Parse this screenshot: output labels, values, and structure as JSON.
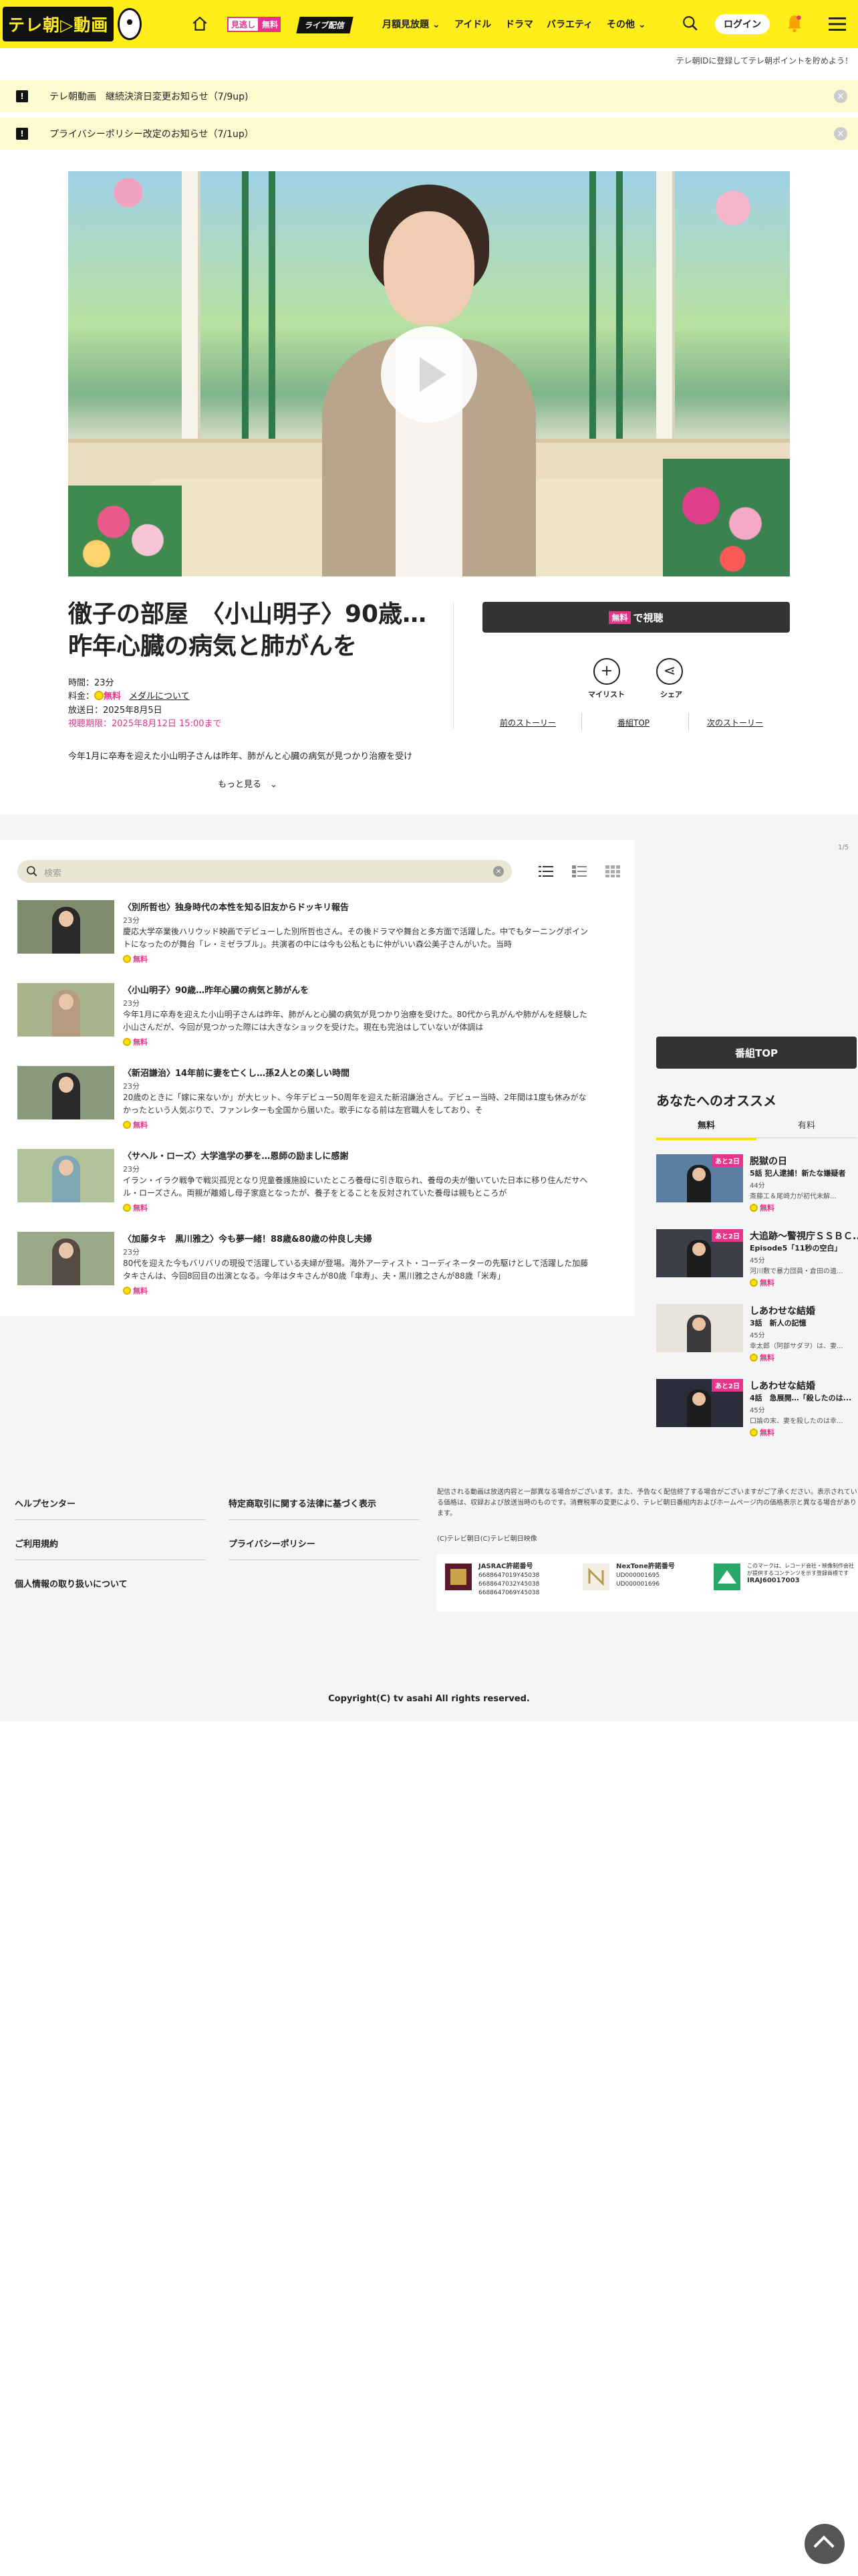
{
  "header": {
    "logo_text": "テレ朝▷動画",
    "free_badge_a": "見逃し",
    "free_badge_b": "無料",
    "live_badge": "ライブ配信",
    "nav": [
      "月額見放題",
      "アイドル",
      "ドラマ",
      "バラエティ",
      "その他"
    ],
    "login": "ログイン"
  },
  "promo": "テレ朝IDに登録してテレ朝ポイントを貯めよう！",
  "notices": [
    {
      "text": "テレ朝動画　継続決済日変更お知らせ（7/9up)"
    },
    {
      "text": "プライバシーポリシー改定のお知らせ（7/1up）"
    }
  ],
  "program": {
    "title": "徹子の部屋　〈小山明子〉90歳…昨年心臓の病気と肺がんを",
    "time": "時間：23分",
    "fee_label": "料金：",
    "fee_value": "無料",
    "medal_link": "メダルについて",
    "aired": "放送日：2025年8月5日",
    "deadline": "視聴期限：2025年8月12日 15:00まで",
    "desc": "今年1月に卒寿を迎えた小山明子さんは昨年、肺がんと心臓の病気が見つかり治療を受け",
    "more": "もっと見る",
    "watch_tag": "無料",
    "watch_label": "で視聴",
    "mylist": "マイリスト",
    "share": "シェア",
    "prev": "前のストーリー",
    "top": "番組TOP",
    "next": "次のストーリー"
  },
  "search": {
    "placeholder": "検索"
  },
  "page_num": "1/5",
  "episodes": [
    {
      "title": "〈別所哲也〉独身時代の本性を知る旧友からドッキリ報告",
      "duration": "23分",
      "desc": "慶応大学卒業後ハリウッド映画でデビューした別所哲也さん。その後ドラマや舞台と多方面で活躍した。中でもターニングポイントになったのが舞台「レ・ミゼラブル」。共演者の中には今も公私ともに仲がいい森公美子さんがいた。当時",
      "free": "無料"
    },
    {
      "title": "〈小山明子〉90歳…昨年心臓の病気と肺がんを",
      "duration": "23分",
      "desc": "今年1月に卒寿を迎えた小山明子さんは昨年、肺がんと心臓の病気が見つかり治療を受けた。80代から乳がんや肺がんを経験した小山さんだが、今回が見つかった際には大きなショックを受けた。現在も完治はしていないが体調は",
      "free": "無料"
    },
    {
      "title": "〈新沼謙治〉14年前に妻を亡くし…孫2人との楽しい時間",
      "duration": "23分",
      "desc": "20歳のときに「嫁に来ないか」が大ヒット、今年デビュー50周年を迎えた新沼謙治さん。デビュー当時、2年間は1度も休みがなかったという人気ぶりで、ファンレターも全国から届いた。歌手になる前は左官職人をしており、そ",
      "free": "無料"
    },
    {
      "title": "〈サヘル・ローズ〉大学進学の夢を…恩師の励ましに感謝",
      "duration": "23分",
      "desc": "イラン・イラク戦争で戦災孤児となり児童養護施設にいたところ養母に引き取られ、養母の夫が働いていた日本に移り住んだサヘル・ローズさん。両親が離婚し母子家庭となったが、養子をとることを反対されていた養母は親もところが",
      "free": "無料"
    },
    {
      "title": "〈加藤タキ　黒川雅之〉今も夢一緒！88歳&80歳の仲良し夫婦",
      "duration": "23分",
      "desc": "80代を迎えた今もバリバリの現役で活躍している夫婦が登場。海外アーティスト・コーディネーターの先駆けとして活躍した加藤タキさんは、今回8回目の出演となる。今年はタキさんが80歳「傘寿」、夫・黒川雅之さんが88歳「米寿」",
      "free": "無料"
    }
  ],
  "sidebar": {
    "program_top": "番組TOP",
    "rec_title": "あなたへのオススメ",
    "tabs": [
      "無料",
      "有料"
    ],
    "items": [
      {
        "tag": "あと2日",
        "l1": "脱獄の日",
        "l2": "5話 犯人逮捕！新たな嫌疑者",
        "l3": "44分",
        "l4": "斎藤工＆尾崎力が初代未解...",
        "free": "無料"
      },
      {
        "tag": "あと2日",
        "l1": "大追跡～警視庁ＳＳＢＣ...",
        "l2": "Episode5「11秒の空白」",
        "l3": "45分",
        "l4": "河川敷で暴力団員・倉田の遺...",
        "free": "無料"
      },
      {
        "tag": "",
        "l1": "しあわせな結婚",
        "l2": "3話　新人の記憶",
        "l3": "45分",
        "l4": "幸太郎（阿部サダヲ）は、妻...",
        "free": "無料"
      },
      {
        "tag": "あと2日",
        "l1": "しあわせな結婚",
        "l2": "4話　急展開…「殺したのは...",
        "l3": "45分",
        "l4": "口論の末、妻を殺したのは幸...",
        "free": "無料"
      }
    ]
  },
  "footer": {
    "left_links": [
      "ヘルプセンター",
      "ご利用規約",
      "個人情報の取り扱いについて"
    ],
    "mid_links": [
      "特定商取引に関する法律に基づく表示",
      "プライバシーポリシー"
    ],
    "note": "配信される動画は放送内容と一部異なる場合がございます。また、予告なく配信終了する場合がございますがご了承ください。表示されている価格は、収録および放送当時のものです。消費税率の変更により、テレビ朝日番組内およびホームページ内の価格表示と異なる場合があります。",
    "copy_small": "(C)テレビ朝日(C)テレビ朝日映像",
    "jasrac_title": "JASRAC許諾番号",
    "jasrac_lines": [
      "6688647019Y45038",
      "6688647032Y45038",
      "6688647069Y45038"
    ],
    "nextone_title": "NexTone許諾番号",
    "nextone_lines": [
      "UD000001695",
      "UD000001696"
    ],
    "ira_text": "このマークは、レコード会社・映像制作会社が提供するコンテンツを示す登録商標です",
    "ira_code": "IRAJ60017003",
    "copyright": "Copyright(C) tv asahi All rights reserved."
  }
}
